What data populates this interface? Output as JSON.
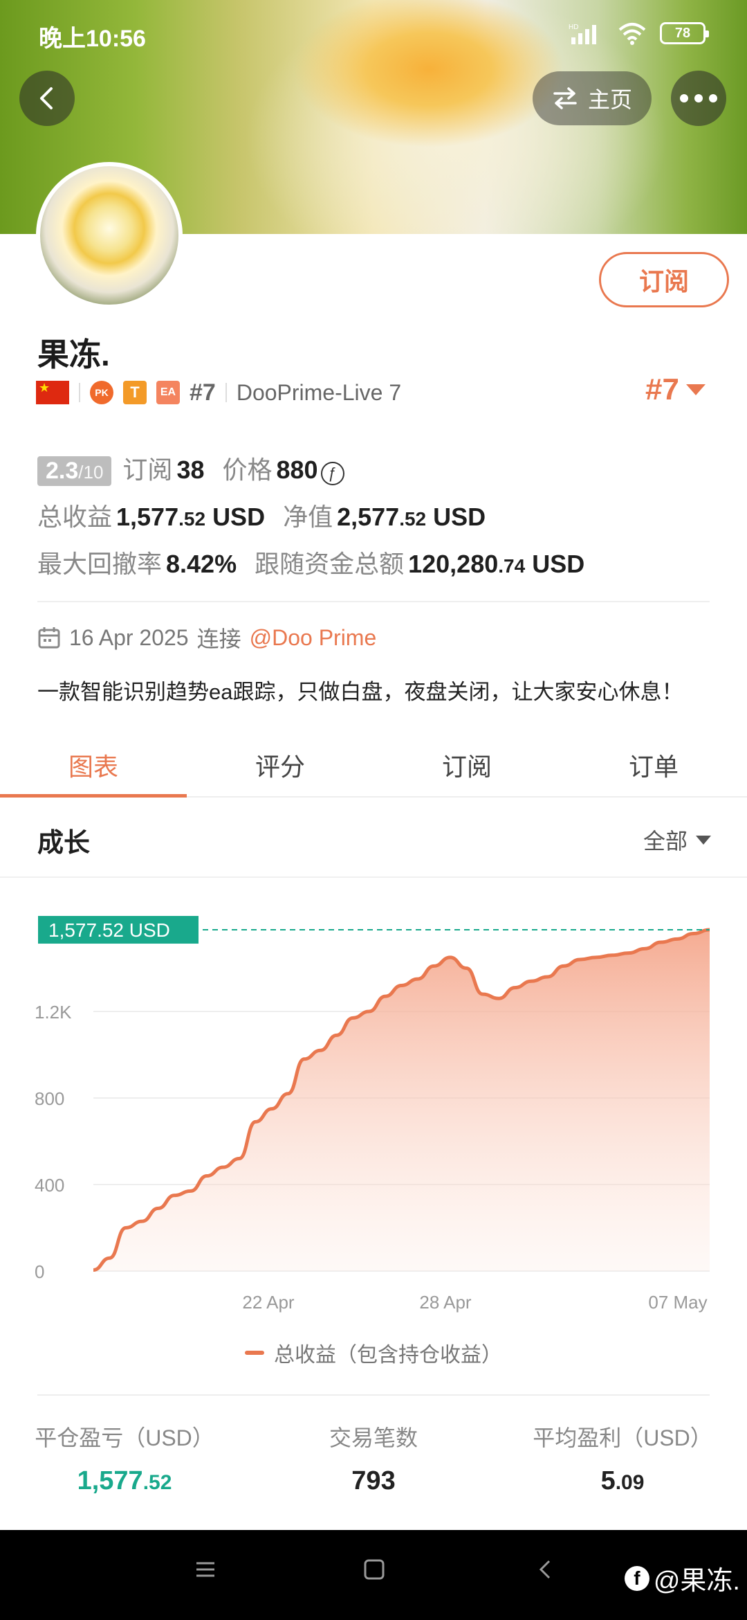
{
  "status_bar": {
    "time": "晚上10:56",
    "battery": "78"
  },
  "header": {
    "home_label": "主页"
  },
  "profile": {
    "name": "果冻.",
    "subscribe_label": "订阅",
    "rank_small": "#7",
    "server": "DooPrime-Live 7",
    "rank_big": "#7",
    "badges": {
      "pk": "PK",
      "t": "T",
      "ea": "EA"
    }
  },
  "stats": {
    "score_main": "2.3",
    "score_sub": "/10",
    "subscriptions_label": "订阅",
    "subscriptions": "38",
    "price_label": "价格",
    "price": "880",
    "total_profit_label": "总收益",
    "total_profit_int": "1,577",
    "total_profit_dec": ".52",
    "total_profit_unit": "USD",
    "equity_label": "净值",
    "equity_int": "2,577",
    "equity_dec": ".52",
    "equity_unit": "USD",
    "drawdown_label": "最大回撤率",
    "drawdown": "8.42%",
    "follow_funds_label": "跟随资金总额",
    "follow_funds_int": "120,280",
    "follow_funds_dec": ".74",
    "follow_funds_unit": "USD"
  },
  "connect": {
    "date": "16 Apr 2025",
    "text": "连接",
    "broker": "@Doo Prime"
  },
  "description": "一款智能识别趋势ea跟踪，只做白盘，夜盘关闭，让大家安心休息！",
  "tabs": [
    "图表",
    "评分",
    "订阅",
    "订单"
  ],
  "growth": {
    "title": "成长",
    "range": "全部"
  },
  "chart_data": {
    "type": "area",
    "y_ticks": [
      "0",
      "400",
      "800",
      "1.2K"
    ],
    "x_ticks": [
      "22 Apr",
      "28 Apr",
      "07 May"
    ],
    "ylim": [
      0,
      1600
    ],
    "current_label": "1,577.52 USD",
    "current_value": 1577.52,
    "series": [
      {
        "name": "总收益（包含持仓收益）",
        "values": [
          5,
          60,
          200,
          230,
          290,
          350,
          370,
          440,
          480,
          520,
          690,
          750,
          820,
          980,
          1020,
          1090,
          1170,
          1200,
          1270,
          1320,
          1350,
          1410,
          1450,
          1400,
          1280,
          1260,
          1310,
          1340,
          1360,
          1410,
          1440,
          1450,
          1460,
          1470,
          1490,
          1520,
          1535,
          1560,
          1577.52
        ]
      }
    ],
    "line_color": "#e9784f",
    "label_color": "#19a98c"
  },
  "legend_label": "总收益（包含持仓收益）",
  "summary": [
    {
      "label": "平仓盈亏（USD）",
      "int": "1,577",
      "dec": ".52"
    },
    {
      "label": "交易笔数",
      "int": "793",
      "dec": ""
    },
    {
      "label": "平均盈利（USD）",
      "int": "5",
      "dec": ".09"
    }
  ],
  "watermark": "@果冻."
}
